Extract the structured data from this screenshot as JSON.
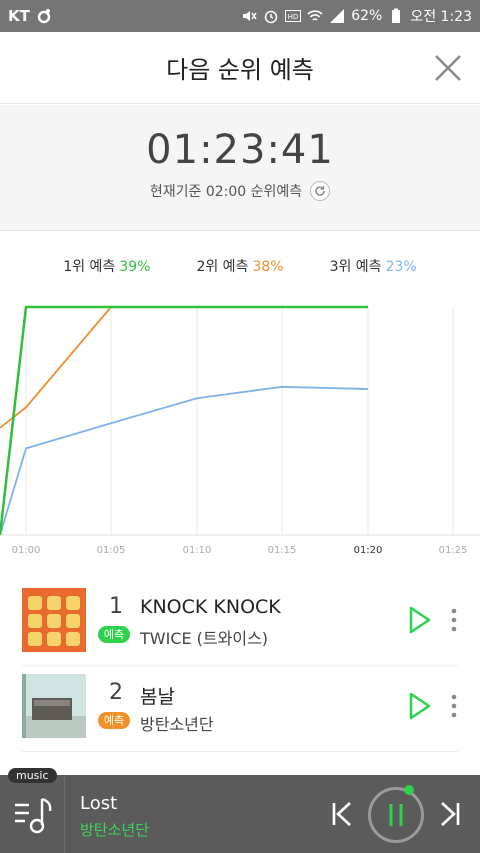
{
  "status_bar": {
    "carrier": "KT",
    "battery": "62%",
    "time": "오전 1:23"
  },
  "header": {
    "title": "다음 순위 예측"
  },
  "timer": {
    "countdown": "01:23:41",
    "subtitle": "현재기준 02:00 순위예측"
  },
  "legend": [
    {
      "label": "1위 예측",
      "percent": "39%",
      "color": "#2fbf3a"
    },
    {
      "label": "2위 예측",
      "percent": "38%",
      "color": "#f08c2a"
    },
    {
      "label": "3위 예측",
      "percent": "23%",
      "color": "#7fb2ea"
    }
  ],
  "chart_data": {
    "type": "line",
    "x": [
      "00:59",
      "01:00",
      "01:05",
      "01:10",
      "01:15",
      "01:20"
    ],
    "xticks": [
      "01:00",
      "01:05",
      "01:10",
      "01:15",
      "01:20",
      "01:25"
    ],
    "highlighted_tick": "01:20",
    "grid": true,
    "series": [
      {
        "color": "#2fbf3a",
        "values": [
          0,
          100,
          100,
          100,
          100,
          100
        ]
      },
      {
        "color": "#f08c2a",
        "values": [
          47,
          56,
          100,
          100,
          100,
          100
        ]
      },
      {
        "color": "#7fb2ea",
        "values": [
          0,
          38,
          49,
          60,
          65,
          64
        ]
      }
    ]
  },
  "tracks": [
    {
      "rank": "1",
      "badge": "예측",
      "badge_color": "#2ed24a",
      "title": "KNOCK KNOCK",
      "artist": "TWICE (트와이스)"
    },
    {
      "rank": "2",
      "badge": "예측",
      "badge_color": "#f0922a",
      "title": "봄날",
      "artist": "방탄소년단"
    }
  ],
  "player": {
    "tag": "music",
    "title": "Lost",
    "artist": "방탄소년단"
  }
}
